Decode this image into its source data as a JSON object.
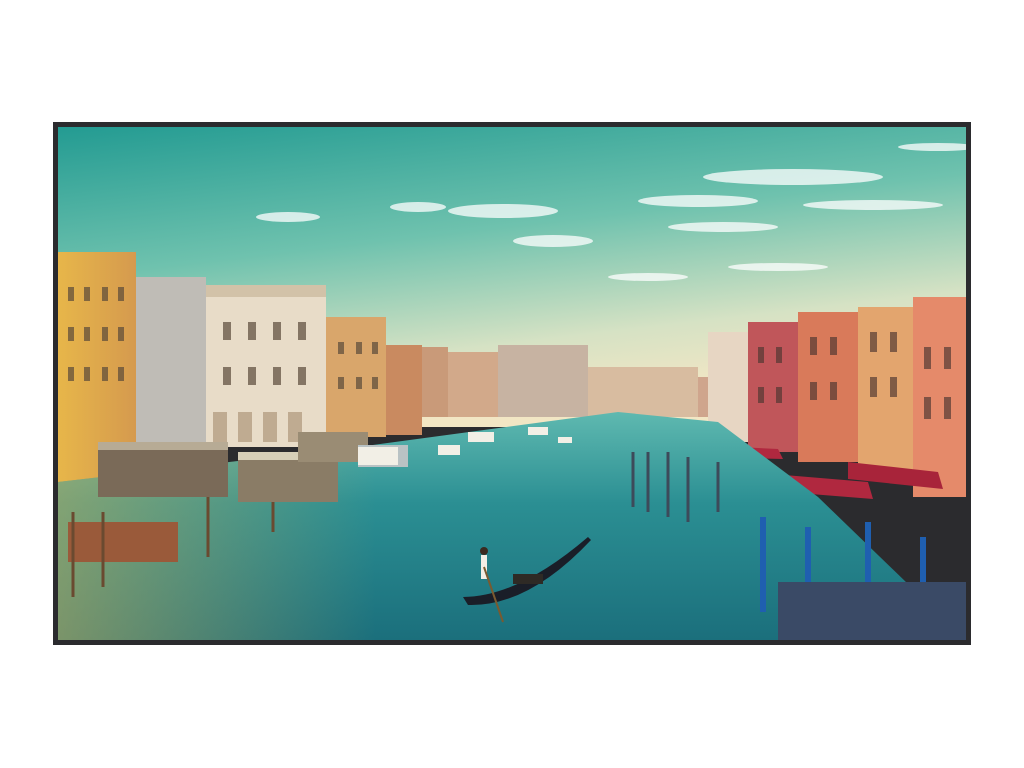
{
  "scene": {
    "subject": "grand-canal-venice",
    "colors": {
      "sky_top": "#2fa89b",
      "sky_mid": "#7fc9b4",
      "sky_horizon": "#e9e4c8",
      "water_near": "#1e7c86",
      "water_far": "#4fb0aa",
      "bezel": "#2b2b2e",
      "awning": "#b0283f"
    }
  }
}
